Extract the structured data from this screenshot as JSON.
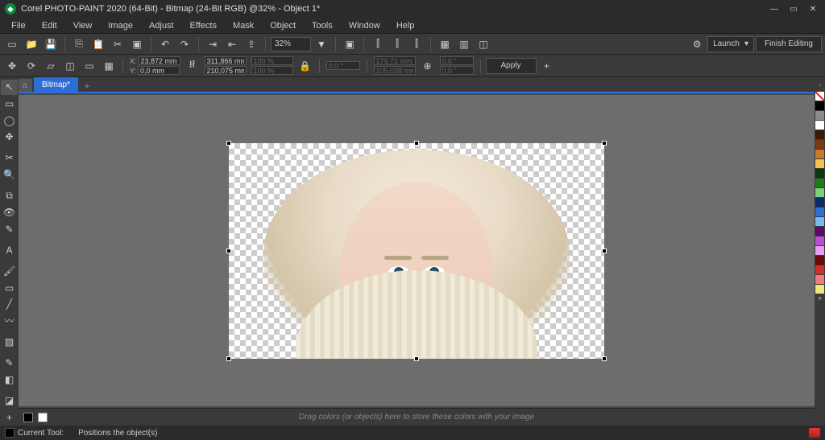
{
  "titlebar": {
    "title": "Corel PHOTO-PAINT 2020 (64-Bit) - Bitmap (24-Bit RGB) @32% - Object 1*"
  },
  "menu": [
    "File",
    "Edit",
    "View",
    "Image",
    "Adjust",
    "Effects",
    "Mask",
    "Object",
    "Tools",
    "Window",
    "Help"
  ],
  "toolbar": {
    "zoom": "32%",
    "launch": "Launch",
    "finish": "Finish Editing"
  },
  "propbar": {
    "x_label": "X:",
    "y_label": "Y:",
    "x": "23,872 mm",
    "y": "0,0 mm",
    "w": "311,866 mm",
    "h": "210,075 mm",
    "sx": "100 %",
    "sy": "100 %",
    "rot": "0,0 °",
    "skx": "179,71 mm",
    "sky": "105,038 mm",
    "a1": "0,0 °",
    "a2": "0,0 °",
    "apply": "Apply"
  },
  "tabs": {
    "active": "Bitmap*"
  },
  "hint": "Drag colors (or objects) here to store these colors with your image",
  "status": {
    "tool_label": "Current Tool:",
    "tool_desc": "Positions the object(s)"
  },
  "palette": [
    "#000000",
    "#8b8b8b",
    "#ffffff",
    "#3a1a0a",
    "#7a3b12",
    "#c97a2b",
    "#f2c14e",
    "#0a3a0a",
    "#1f7a1f",
    "#7ad17a",
    "#0a2a6a",
    "#2d6dd6",
    "#7ab8f2",
    "#5a0a6a",
    "#b84fd1",
    "#e89ff0",
    "#6a0a0a",
    "#d12d2d",
    "#f07a7a",
    "#f0e67a"
  ]
}
